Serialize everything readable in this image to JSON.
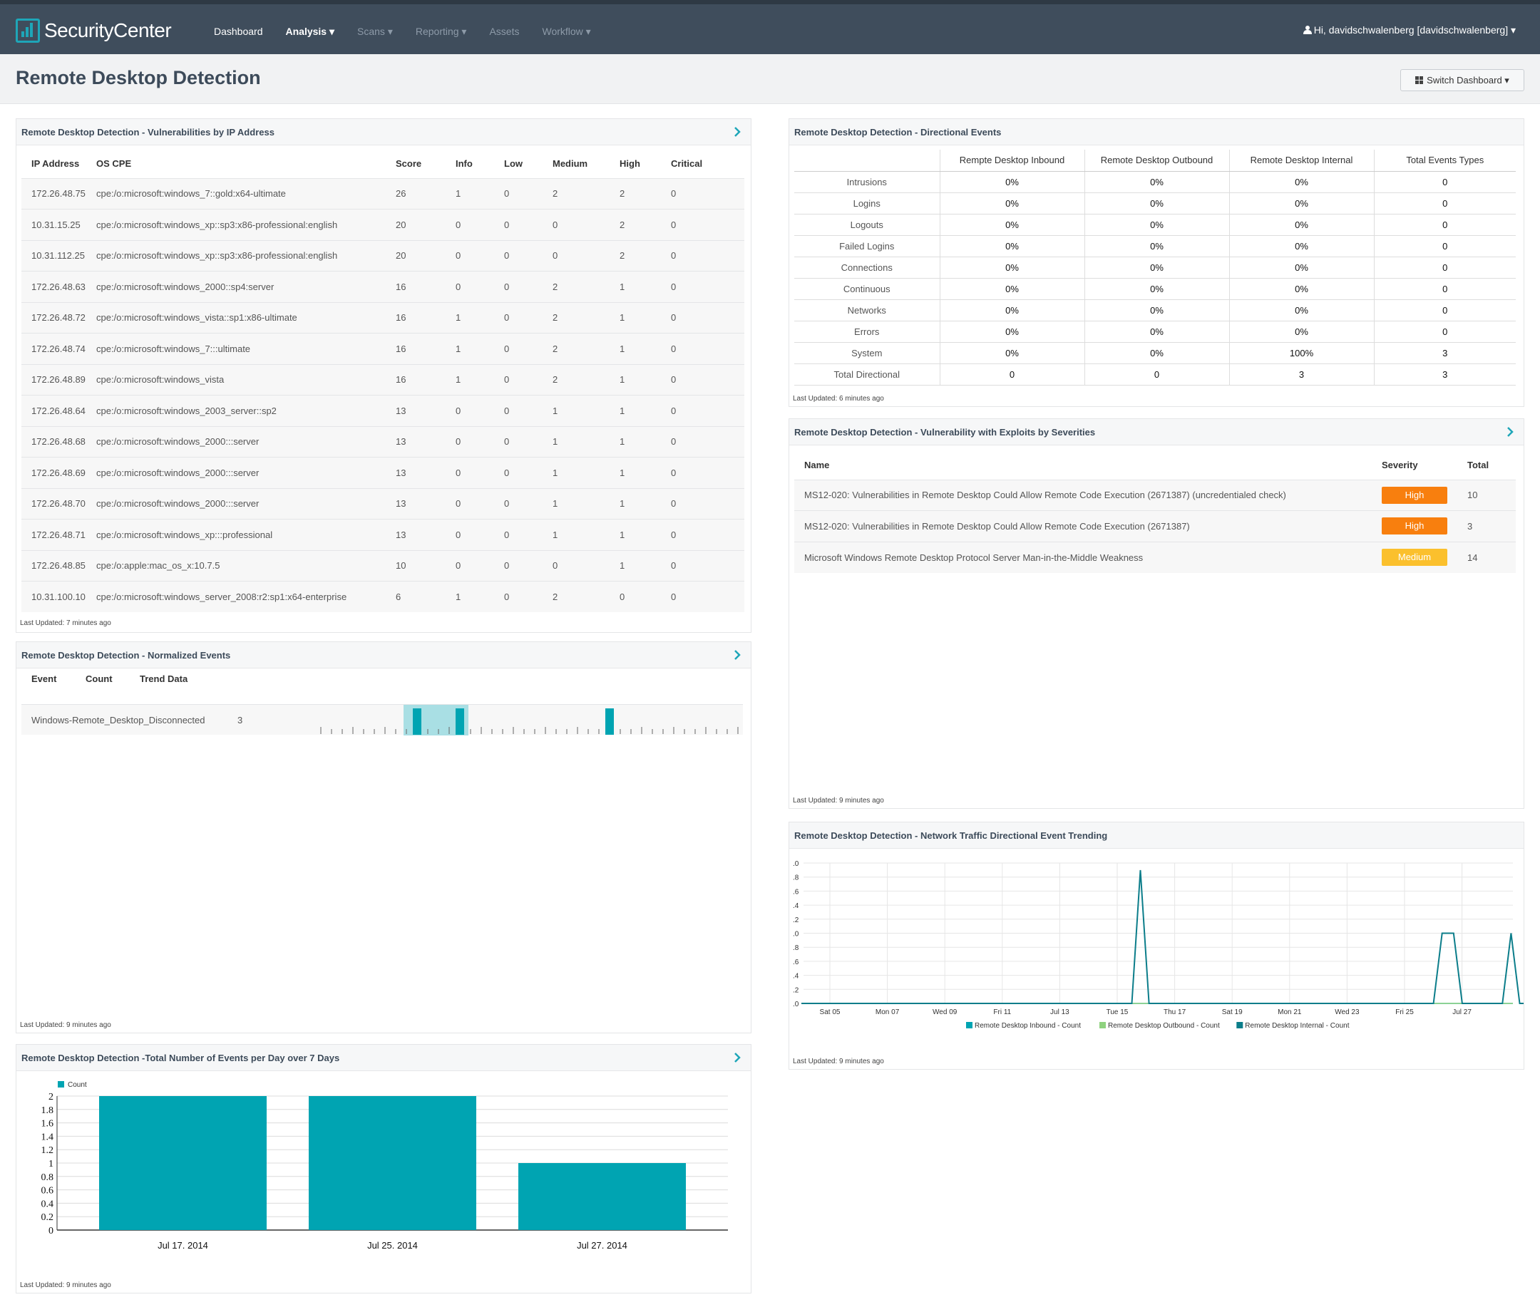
{
  "app": {
    "logo_text": "SecurityCenter",
    "nav": [
      {
        "label": "Dashboard"
      },
      {
        "label": "Analysis ▾"
      },
      {
        "label": "Scans ▾"
      },
      {
        "label": "Reporting ▾"
      },
      {
        "label": "Assets"
      },
      {
        "label": "Workflow ▾"
      }
    ],
    "user_label": "Hi, davidschwalenberg [davidschwalenberg] ▾"
  },
  "page": {
    "title": "Remote Desktop Detection",
    "switch_label": "Switch Dashboard ▾"
  },
  "vuln_panel": {
    "title": "Remote Desktop Detection - Vulnerabilities by IP Address",
    "headers": [
      "IP Address",
      "OS CPE",
      "Score",
      "Info",
      "Low",
      "Medium",
      "High",
      "Critical"
    ],
    "rows": [
      [
        "172.26.48.75",
        "cpe:/o:microsoft:windows_7::gold:x64-ultimate",
        "26",
        "1",
        "0",
        "2",
        "2",
        "0"
      ],
      [
        "10.31.15.25",
        "cpe:/o:microsoft:windows_xp::sp3:x86-professional:english",
        "20",
        "0",
        "0",
        "0",
        "2",
        "0"
      ],
      [
        "10.31.112.25",
        "cpe:/o:microsoft:windows_xp::sp3:x86-professional:english",
        "20",
        "0",
        "0",
        "0",
        "2",
        "0"
      ],
      [
        "172.26.48.63",
        "cpe:/o:microsoft:windows_2000::sp4:server",
        "16",
        "0",
        "0",
        "2",
        "1",
        "0"
      ],
      [
        "172.26.48.72",
        "cpe:/o:microsoft:windows_vista::sp1:x86-ultimate",
        "16",
        "1",
        "0",
        "2",
        "1",
        "0"
      ],
      [
        "172.26.48.74",
        "cpe:/o:microsoft:windows_7:::ultimate",
        "16",
        "1",
        "0",
        "2",
        "1",
        "0"
      ],
      [
        "172.26.48.89",
        "cpe:/o:microsoft:windows_vista",
        "16",
        "1",
        "0",
        "2",
        "1",
        "0"
      ],
      [
        "172.26.48.64",
        "cpe:/o:microsoft:windows_2003_server::sp2",
        "13",
        "0",
        "0",
        "1",
        "1",
        "0"
      ],
      [
        "172.26.48.68",
        "cpe:/o:microsoft:windows_2000:::server",
        "13",
        "0",
        "0",
        "1",
        "1",
        "0"
      ],
      [
        "172.26.48.69",
        "cpe:/o:microsoft:windows_2000:::server",
        "13",
        "0",
        "0",
        "1",
        "1",
        "0"
      ],
      [
        "172.26.48.70",
        "cpe:/o:microsoft:windows_2000:::server",
        "13",
        "0",
        "0",
        "1",
        "1",
        "0"
      ],
      [
        "172.26.48.71",
        "cpe:/o:microsoft:windows_xp:::professional",
        "13",
        "0",
        "0",
        "1",
        "1",
        "0"
      ],
      [
        "172.26.48.85",
        "cpe:/o:apple:mac_os_x:10.7.5",
        "10",
        "0",
        "0",
        "0",
        "1",
        "0"
      ],
      [
        "10.31.100.10",
        "cpe:/o:microsoft:windows_server_2008:r2:sp1:x64-enterprise",
        "6",
        "1",
        "0",
        "2",
        "0",
        "0"
      ]
    ],
    "updated": "Last Updated: 7 minutes ago"
  },
  "dir_panel": {
    "title": "Remote Desktop Detection - Directional Events",
    "headers": [
      "",
      "Rempte Desktop Inbound",
      "Remote Desktop Outbound",
      "Remote Desktop Internal",
      "Total Events Types"
    ],
    "rows": [
      [
        "Intrusions",
        "0%",
        "0%",
        "0%",
        "0"
      ],
      [
        "Logins",
        "0%",
        "0%",
        "0%",
        "0"
      ],
      [
        "Logouts",
        "0%",
        "0%",
        "0%",
        "0"
      ],
      [
        "Failed Logins",
        "0%",
        "0%",
        "0%",
        "0"
      ],
      [
        "Connections",
        "0%",
        "0%",
        "0%",
        "0"
      ],
      [
        "Continuous",
        "0%",
        "0%",
        "0%",
        "0"
      ],
      [
        "Networks",
        "0%",
        "0%",
        "0%",
        "0"
      ],
      [
        "Errors",
        "0%",
        "0%",
        "0%",
        "0"
      ],
      [
        "System",
        "0%",
        "0%",
        "100%",
        "3"
      ],
      [
        "Total Directional",
        "0",
        "0",
        "3",
        "3"
      ]
    ],
    "updated": "Last Updated: 6 minutes ago"
  },
  "exploit_panel": {
    "title": "Remote Desktop Detection - Vulnerability with Exploits by Severities",
    "headers": [
      "Name",
      "Severity",
      "Total"
    ],
    "rows": [
      {
        "name": "MS12-020: Vulnerabilities in Remote Desktop Could Allow Remote Code Execution (2671387) (uncredentialed check)",
        "severity": "High",
        "color": "#f87f0e",
        "total": "10"
      },
      {
        "name": "MS12-020: Vulnerabilities in Remote Desktop Could Allow Remote Code Execution (2671387)",
        "severity": "High",
        "color": "#f87f0e",
        "total": "3"
      },
      {
        "name": "Microsoft Windows Remote Desktop Protocol Server Man-in-the-Middle Weakness",
        "severity": "Medium",
        "color": "#fbc02d",
        "total": "14"
      }
    ],
    "updated": "Last Updated: 9 minutes ago"
  },
  "norm_panel": {
    "title": "Remote Desktop Detection - Normalized Events",
    "headers": [
      "Event",
      "Count",
      "Trend Data"
    ],
    "event": "Windows-Remote_Desktop_Disconnected",
    "count": "3",
    "trend_bars": [
      9,
      13,
      27
    ],
    "trend_highlight": [
      8,
      14
    ],
    "updated": "Last Updated: 9 minutes ago"
  },
  "net_panel": {
    "title": "Remote Desktop Detection - Network Traffic Directional Event Trending",
    "updated": "Last Updated: 9 minutes ago"
  },
  "day_panel": {
    "title": "Remote Desktop Detection -Total Number of Events per Day over 7 Days",
    "updated": "Last Updated: 9 minutes ago"
  },
  "colors": {
    "teal": "#00a4b2",
    "nav_bg": "#3f4d5c"
  },
  "chart_data": [
    {
      "type": "line",
      "name": "Network Traffic Directional Event Trending",
      "x": [
        "Sat 05",
        "Mon 07",
        "Wed 09",
        "Fri 11",
        "Jul 13",
        "Tue 15",
        "Thu 17",
        "Sat 19",
        "Mon 21",
        "Wed 23",
        "Fri 25",
        "Jul 27"
      ],
      "ytick_labels": [
        ".0",
        ".8",
        ".6",
        ".4",
        ".2",
        ".0",
        ".8",
        ".6",
        ".4",
        ".2",
        ".0"
      ],
      "ylim": [
        0,
        2
      ],
      "series": [
        {
          "name": "Remote Desktop Inbound - Count",
          "color": "#00a4b2",
          "points": []
        },
        {
          "name": "Remote Desktop Outbound - Count",
          "color": "#8fd27f",
          "points": []
        },
        {
          "name": "Remote Desktop Internal - Count",
          "color": "#0b7d8a",
          "points": [
            [
              0,
              0
            ],
            [
              11.5,
              0
            ],
            [
              11.8,
              1.9
            ],
            [
              12.1,
              0
            ],
            [
              22.0,
              0
            ],
            [
              22.3,
              1.0
            ],
            [
              22.7,
              1.0
            ],
            [
              23.0,
              0
            ],
            [
              24.4,
              0
            ],
            [
              24.7,
              1.0
            ],
            [
              25.0,
              0
            ],
            [
              26.0,
              0
            ]
          ]
        }
      ],
      "grid": true,
      "legend": "bottom"
    },
    {
      "type": "bar",
      "name": "Total Number of Events per Day over 7 Days",
      "categories": [
        "Jul 17. 2014",
        "Jul 25. 2014",
        "Jul 27. 2014"
      ],
      "series": [
        {
          "name": "Count",
          "values": [
            2,
            2,
            1
          ]
        }
      ],
      "yticks": [
        "2",
        "1.8",
        "1.6",
        "1.4",
        "1.2",
        "1",
        "0.8",
        "0.6",
        "0.4",
        "0.2",
        "0"
      ],
      "ylim": [
        0,
        2
      ],
      "grid": true,
      "legend": "top-left"
    }
  ]
}
